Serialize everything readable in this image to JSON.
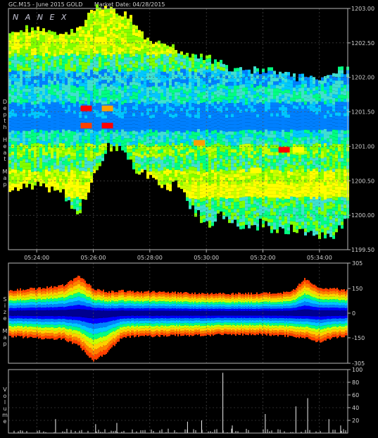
{
  "header": {
    "symbol": "GC.M15 - June 2015 GOLD",
    "market_date": "Market Date: 04/28/2015",
    "watermark": "NANEX"
  },
  "colors": {
    "background": "#000000",
    "panel_border": "#b8b8b8",
    "gridline": "#555555",
    "heat_scale": [
      "#000080",
      "#0000ff",
      "#0080ff",
      "#00c8ff",
      "#40e0d0",
      "#00ff80",
      "#80ff00",
      "#c8ff00",
      "#ffff00",
      "#ffa000",
      "#ff4000",
      "#ff0000"
    ]
  },
  "chart_data": [
    {
      "type": "heatmap",
      "title": "",
      "ylabel": "Depth Heat Map",
      "x_ticks": [
        "05:24:00",
        "05:26:00",
        "05:28:00",
        "05:30:00",
        "05:32:00",
        "05:34:00"
      ],
      "y_ticks": [
        "1199.50",
        "1200.00",
        "1200.50",
        "1201.00",
        "1201.50",
        "1202.00",
        "1202.50",
        "1203.00"
      ],
      "ylim": [
        1199.5,
        1203.0
      ],
      "xlim": [
        "05:23:00",
        "05:35:00"
      ],
      "grid": true,
      "outline": {
        "x": [
          "05:23:00",
          "05:24:00",
          "05:25:00",
          "05:25:30",
          "05:26:00",
          "05:26:30",
          "05:27:00",
          "05:27:30",
          "05:28:00",
          "05:28:30",
          "05:29:00",
          "05:29:30",
          "05:30:00",
          "05:30:30",
          "05:31:00",
          "05:31:30",
          "05:32:00",
          "05:32:30",
          "05:33:00",
          "05:33:30",
          "05:34:00",
          "05:34:30",
          "05:35:00"
        ],
        "high": [
          1202.7,
          1202.7,
          1202.6,
          1202.7,
          1203.0,
          1203.0,
          1202.95,
          1202.8,
          1202.5,
          1202.5,
          1202.4,
          1202.3,
          1202.3,
          1202.2,
          1202.1,
          1202.1,
          1202.1,
          1202.1,
          1202.0,
          1202.0,
          1202.0,
          1202.1,
          1202.1
        ],
        "low": [
          1200.3,
          1200.5,
          1200.3,
          1200.0,
          1200.6,
          1201.0,
          1201.0,
          1200.7,
          1200.6,
          1200.4,
          1200.5,
          1200.1,
          1199.9,
          1200.0,
          1199.9,
          1199.8,
          1199.9,
          1199.8,
          1199.8,
          1199.8,
          1199.7,
          1199.7,
          1200.0
        ]
      },
      "bands": [
        {
          "price": 1202.45,
          "level": 7
        },
        {
          "price": 1202.2,
          "level": 5
        },
        {
          "price": 1202.0,
          "level": 3
        },
        {
          "price": 1201.75,
          "level": 4
        },
        {
          "price": 1201.5,
          "level": 2
        },
        {
          "price": 1201.35,
          "level": 1
        },
        {
          "price": 1201.1,
          "level": 4
        },
        {
          "price": 1200.95,
          "level": 6
        },
        {
          "price": 1200.75,
          "level": 5
        },
        {
          "price": 1200.55,
          "level": 7
        },
        {
          "price": 1200.35,
          "level": 8
        },
        {
          "price": 1200.15,
          "level": 5
        }
      ],
      "hot_spots": [
        {
          "time": "05:25:45",
          "price": 1201.55,
          "level": 11
        },
        {
          "time": "05:25:45",
          "price": 1201.3,
          "level": 10
        },
        {
          "time": "05:26:30",
          "price": 1201.3,
          "level": 11
        },
        {
          "time": "05:26:30",
          "price": 1201.55,
          "level": 9
        },
        {
          "time": "05:26:15",
          "price": 1202.55,
          "level": 8
        },
        {
          "time": "05:32:45",
          "price": 1200.95,
          "level": 11
        },
        {
          "time": "05:33:15",
          "price": 1200.95,
          "level": 8
        },
        {
          "time": "05:31:45",
          "price": 1200.65,
          "level": 8
        },
        {
          "time": "05:29:45",
          "price": 1201.05,
          "level": 9
        }
      ]
    },
    {
      "type": "heatmap",
      "title": "",
      "ylabel": "Size Map",
      "y_ticks": [
        "-305",
        "-150",
        "0",
        "150",
        "305"
      ],
      "ylim": [
        -305,
        305
      ],
      "xlim": [
        "05:23:00",
        "05:35:00"
      ],
      "grid": true,
      "envelope": {
        "x": [
          "05:23:00",
          "05:24:00",
          "05:25:00",
          "05:25:30",
          "05:26:00",
          "05:26:30",
          "05:27:00",
          "05:27:30",
          "05:28:00",
          "05:29:00",
          "05:30:00",
          "05:31:00",
          "05:32:00",
          "05:33:00",
          "05:33:30",
          "05:34:00",
          "05:34:30",
          "05:35:00"
        ],
        "upper": [
          140,
          150,
          170,
          230,
          150,
          130,
          135,
          130,
          130,
          125,
          120,
          120,
          120,
          125,
          210,
          150,
          150,
          140
        ],
        "lower": [
          -140,
          -150,
          -160,
          -200,
          -290,
          -240,
          -150,
          -140,
          -140,
          -135,
          -135,
          -130,
          -130,
          -140,
          -150,
          -175,
          -150,
          -140
        ]
      }
    },
    {
      "type": "bar",
      "title": "",
      "ylabel": "Volume",
      "y_ticks": [
        "20",
        "40",
        "60",
        "80",
        "100"
      ],
      "ylim": [
        0,
        100
      ],
      "xlim": [
        "05:23:00",
        "05:35:00"
      ],
      "grid": true,
      "spikes": [
        {
          "time": "05:24:40",
          "value": 22
        },
        {
          "time": "05:26:05",
          "value": 14
        },
        {
          "time": "05:26:50",
          "value": 16
        },
        {
          "time": "05:29:20",
          "value": 18
        },
        {
          "time": "05:29:50",
          "value": 20
        },
        {
          "time": "05:30:35",
          "value": 95
        },
        {
          "time": "05:30:55",
          "value": 12
        },
        {
          "time": "05:32:05",
          "value": 30
        },
        {
          "time": "05:33:10",
          "value": 42
        },
        {
          "time": "05:33:35",
          "value": 55
        },
        {
          "time": "05:34:20",
          "value": 22
        },
        {
          "time": "05:34:45",
          "value": 12
        }
      ]
    }
  ]
}
